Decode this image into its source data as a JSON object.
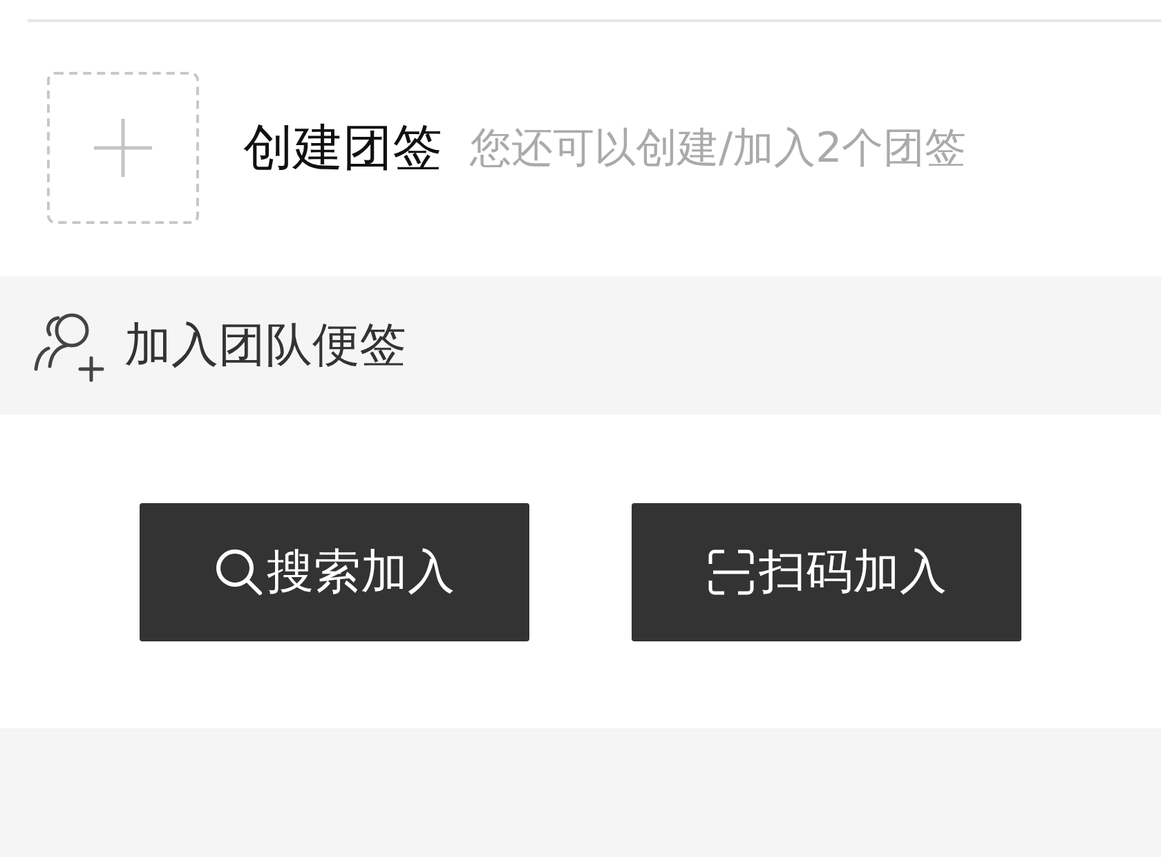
{
  "create": {
    "title": "创建团签",
    "hint": "您还可以创建/加入2个团签"
  },
  "join_section": {
    "title": "加入团队便签"
  },
  "buttons": [
    {
      "kind": "search",
      "label": "搜索加入"
    },
    {
      "kind": "scan",
      "label": "扫码加入"
    }
  ]
}
